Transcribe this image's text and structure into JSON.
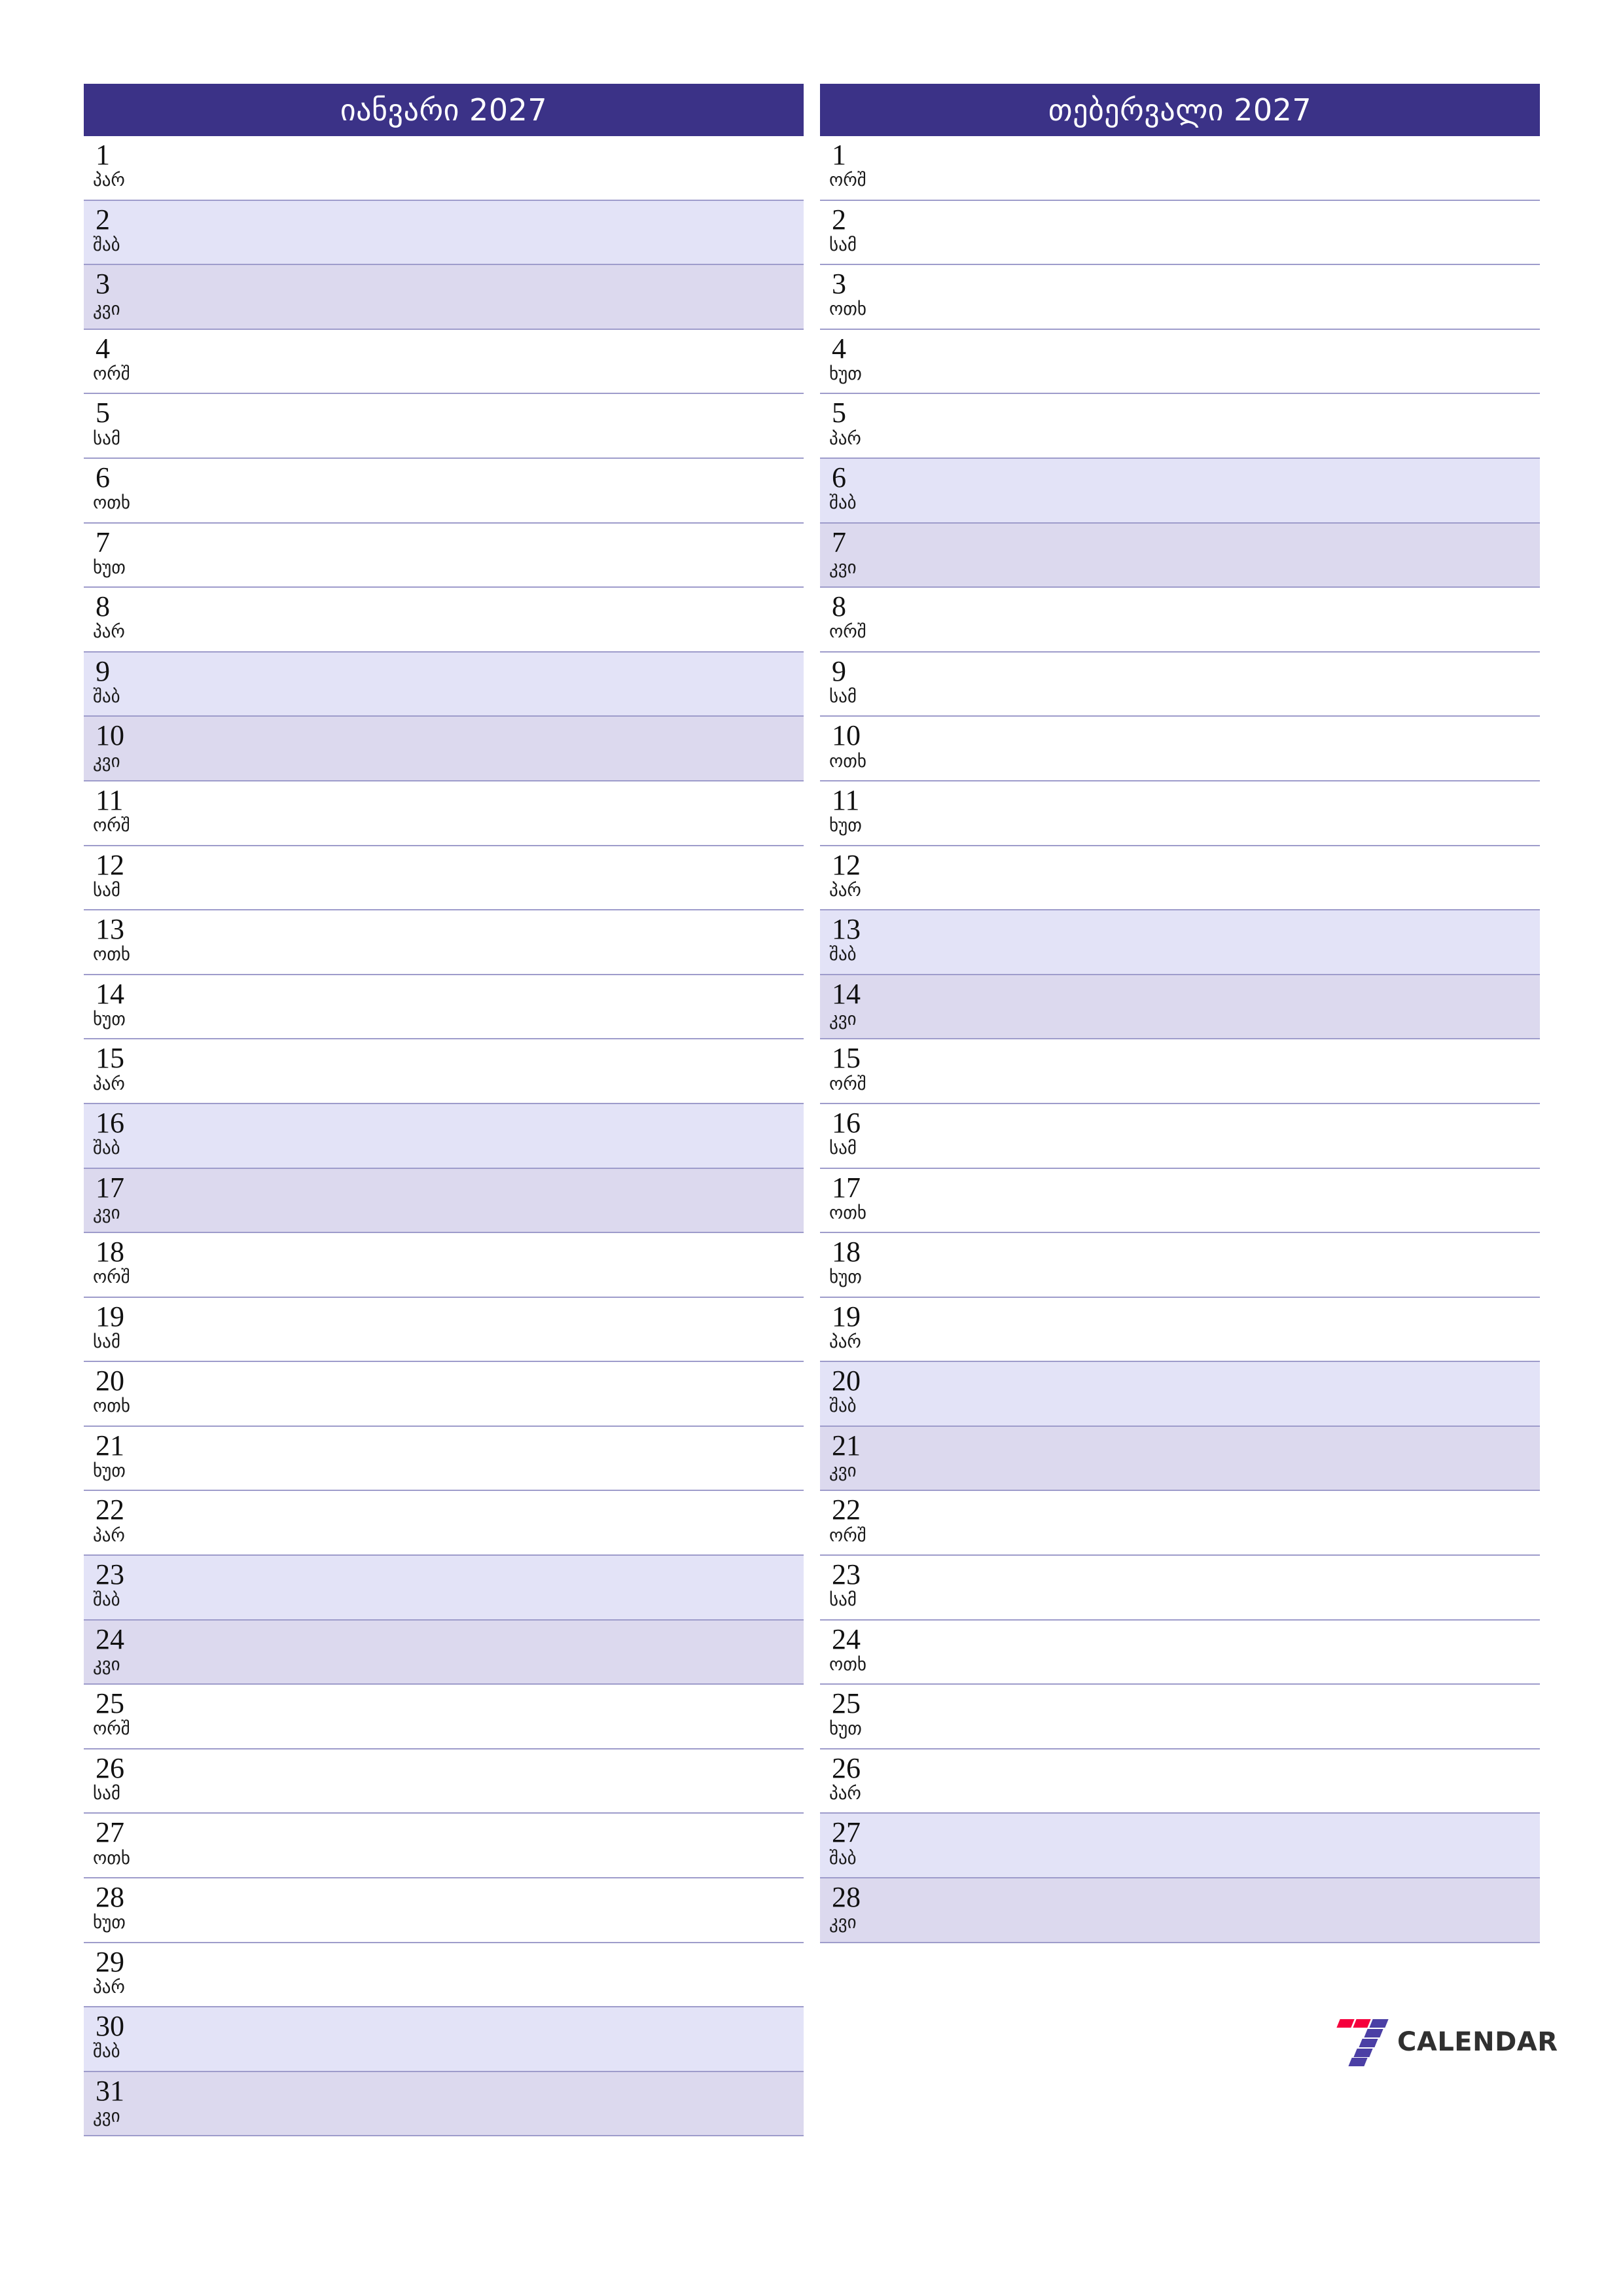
{
  "document": {
    "type": "monthly-planner",
    "year": "2027",
    "locale": "ka-GE"
  },
  "colors": {
    "header_bg": "#3b3287",
    "header_text": "#ffffff",
    "saturday_bg": "#e3e3f7",
    "sunday_bg": "#dcd9ee",
    "row_border": "#9e9ccb",
    "page_bg": "#ffffff",
    "logo_red": "#f5003c",
    "logo_purple": "#4b3fa5",
    "logo_text": "#303030"
  },
  "weekdays": {
    "mon": "ორშ",
    "tue": "სამ",
    "wed": "ოთხ",
    "thu": "ხუთ",
    "fri": "პარ",
    "sat": "შაბ",
    "sun": "კვი"
  },
  "months": [
    {
      "title": "იანვარი 2027",
      "name": "იანვარი",
      "year": "2027",
      "days": [
        {
          "num": "1",
          "wd": "პარ",
          "kind": "weekday"
        },
        {
          "num": "2",
          "wd": "შაბ",
          "kind": "sat"
        },
        {
          "num": "3",
          "wd": "კვი",
          "kind": "sun"
        },
        {
          "num": "4",
          "wd": "ორშ",
          "kind": "weekday"
        },
        {
          "num": "5",
          "wd": "სამ",
          "kind": "weekday"
        },
        {
          "num": "6",
          "wd": "ოთხ",
          "kind": "weekday"
        },
        {
          "num": "7",
          "wd": "ხუთ",
          "kind": "weekday"
        },
        {
          "num": "8",
          "wd": "პარ",
          "kind": "weekday"
        },
        {
          "num": "9",
          "wd": "შაბ",
          "kind": "sat"
        },
        {
          "num": "10",
          "wd": "კვი",
          "kind": "sun"
        },
        {
          "num": "11",
          "wd": "ორშ",
          "kind": "weekday"
        },
        {
          "num": "12",
          "wd": "სამ",
          "kind": "weekday"
        },
        {
          "num": "13",
          "wd": "ოთხ",
          "kind": "weekday"
        },
        {
          "num": "14",
          "wd": "ხუთ",
          "kind": "weekday"
        },
        {
          "num": "15",
          "wd": "პარ",
          "kind": "weekday"
        },
        {
          "num": "16",
          "wd": "შაბ",
          "kind": "sat"
        },
        {
          "num": "17",
          "wd": "კვი",
          "kind": "sun"
        },
        {
          "num": "18",
          "wd": "ორშ",
          "kind": "weekday"
        },
        {
          "num": "19",
          "wd": "სამ",
          "kind": "weekday"
        },
        {
          "num": "20",
          "wd": "ოთხ",
          "kind": "weekday"
        },
        {
          "num": "21",
          "wd": "ხუთ",
          "kind": "weekday"
        },
        {
          "num": "22",
          "wd": "პარ",
          "kind": "weekday"
        },
        {
          "num": "23",
          "wd": "შაბ",
          "kind": "sat"
        },
        {
          "num": "24",
          "wd": "კვი",
          "kind": "sun"
        },
        {
          "num": "25",
          "wd": "ორშ",
          "kind": "weekday"
        },
        {
          "num": "26",
          "wd": "სამ",
          "kind": "weekday"
        },
        {
          "num": "27",
          "wd": "ოთხ",
          "kind": "weekday"
        },
        {
          "num": "28",
          "wd": "ხუთ",
          "kind": "weekday"
        },
        {
          "num": "29",
          "wd": "პარ",
          "kind": "weekday"
        },
        {
          "num": "30",
          "wd": "შაბ",
          "kind": "sat"
        },
        {
          "num": "31",
          "wd": "კვი",
          "kind": "sun"
        }
      ]
    },
    {
      "title": "თებერვალი 2027",
      "name": "თებერვალი",
      "year": "2027",
      "days": [
        {
          "num": "1",
          "wd": "ორშ",
          "kind": "weekday"
        },
        {
          "num": "2",
          "wd": "სამ",
          "kind": "weekday"
        },
        {
          "num": "3",
          "wd": "ოთხ",
          "kind": "weekday"
        },
        {
          "num": "4",
          "wd": "ხუთ",
          "kind": "weekday"
        },
        {
          "num": "5",
          "wd": "პარ",
          "kind": "weekday"
        },
        {
          "num": "6",
          "wd": "შაბ",
          "kind": "sat"
        },
        {
          "num": "7",
          "wd": "კვი",
          "kind": "sun"
        },
        {
          "num": "8",
          "wd": "ორშ",
          "kind": "weekday"
        },
        {
          "num": "9",
          "wd": "სამ",
          "kind": "weekday"
        },
        {
          "num": "10",
          "wd": "ოთხ",
          "kind": "weekday"
        },
        {
          "num": "11",
          "wd": "ხუთ",
          "kind": "weekday"
        },
        {
          "num": "12",
          "wd": "პარ",
          "kind": "weekday"
        },
        {
          "num": "13",
          "wd": "შაბ",
          "kind": "sat"
        },
        {
          "num": "14",
          "wd": "კვი",
          "kind": "sun"
        },
        {
          "num": "15",
          "wd": "ორშ",
          "kind": "weekday"
        },
        {
          "num": "16",
          "wd": "სამ",
          "kind": "weekday"
        },
        {
          "num": "17",
          "wd": "ოთხ",
          "kind": "weekday"
        },
        {
          "num": "18",
          "wd": "ხუთ",
          "kind": "weekday"
        },
        {
          "num": "19",
          "wd": "პარ",
          "kind": "weekday"
        },
        {
          "num": "20",
          "wd": "შაბ",
          "kind": "sat"
        },
        {
          "num": "21",
          "wd": "კვი",
          "kind": "sun"
        },
        {
          "num": "22",
          "wd": "ორშ",
          "kind": "weekday"
        },
        {
          "num": "23",
          "wd": "სამ",
          "kind": "weekday"
        },
        {
          "num": "24",
          "wd": "ოთხ",
          "kind": "weekday"
        },
        {
          "num": "25",
          "wd": "ხუთ",
          "kind": "weekday"
        },
        {
          "num": "26",
          "wd": "პარ",
          "kind": "weekday"
        },
        {
          "num": "27",
          "wd": "შაბ",
          "kind": "sat"
        },
        {
          "num": "28",
          "wd": "კვი",
          "kind": "sun"
        }
      ]
    }
  ],
  "logo": {
    "mark": "seven-logo-icon",
    "text": "CALENDAR"
  }
}
